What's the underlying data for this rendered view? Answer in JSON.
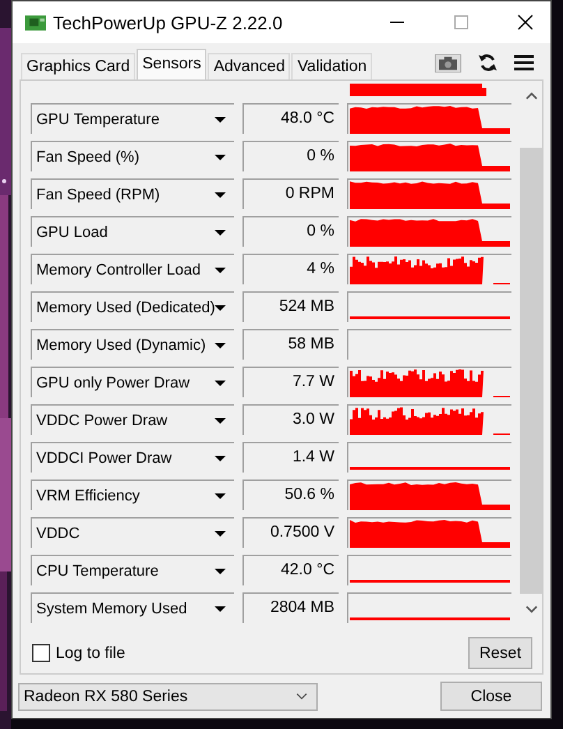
{
  "window": {
    "title": "TechPowerUp GPU-Z 2.22.0"
  },
  "tabs": [
    {
      "label": "Graphics Card",
      "selected": false
    },
    {
      "label": "Sensors",
      "selected": true
    },
    {
      "label": "Advanced",
      "selected": false
    },
    {
      "label": "Validation",
      "selected": false
    }
  ],
  "sensors": [
    {
      "name": "GPU Temperature",
      "value": "48.0 °C"
    },
    {
      "name": "Fan Speed (%)",
      "value": "0 %"
    },
    {
      "name": "Fan Speed (RPM)",
      "value": "0 RPM"
    },
    {
      "name": "GPU Load",
      "value": "0 %"
    },
    {
      "name": "Memory Controller Load",
      "value": "4 %"
    },
    {
      "name": "Memory Used (Dedicated)",
      "value": "524 MB"
    },
    {
      "name": "Memory Used (Dynamic)",
      "value": "58 MB"
    },
    {
      "name": "GPU only Power Draw",
      "value": "7.7 W"
    },
    {
      "name": "VDDC Power Draw",
      "value": "3.0 W"
    },
    {
      "name": "VDDCI Power Draw",
      "value": "1.4 W"
    },
    {
      "name": "VRM Efficiency",
      "value": "50.6 %"
    },
    {
      "name": "VDDC",
      "value": "0.7500 V"
    },
    {
      "name": "CPU Temperature",
      "value": "42.0 °C"
    },
    {
      "name": "System Memory Used",
      "value": "2804 MB"
    }
  ],
  "log_to_file": {
    "label": "Log to file",
    "checked": false
  },
  "reset_button": "Reset",
  "gpu_select": {
    "value": "Radeon RX 580 Series"
  },
  "close_button": "Close"
}
